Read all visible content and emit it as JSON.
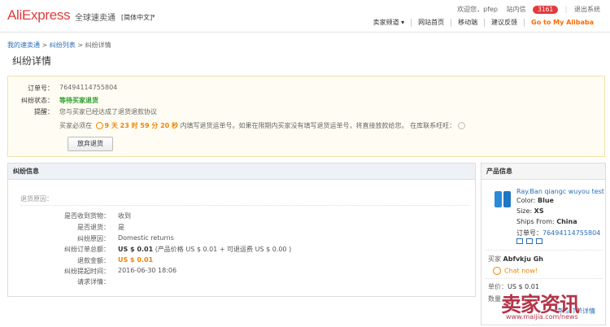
{
  "header": {
    "logo_main": "AliExpress",
    "logo_sub": "全球速卖通",
    "language": "[简体中文]",
    "greeting": "欢迎您，",
    "username": "pfep",
    "inbox_label": "站内信",
    "inbox_count": "3161",
    "logout": "退出系统",
    "nav": [
      "卖家频道",
      "网站首页",
      "移动端",
      "建议反馈"
    ],
    "alibaba": "Go to My Alibaba"
  },
  "breadcrumb": {
    "items": [
      "我的速卖通",
      "纠纷列表",
      "纠纷详情"
    ],
    "separator": ">"
  },
  "page_title": "纠纷详情",
  "summary": {
    "order_label": "订单号：",
    "order_no": "76494114755804",
    "status_label": "纠纷状态：",
    "status": "等待买家退货",
    "tip_label": "提醒：",
    "tip": "您与买家已经达成了退货退款协议",
    "countdown_prefix": "买家必须在",
    "countdown": "9 天 23 时 59 分 20 秒",
    "countdown_suffix": "内填写退货运单号。如果在限期内买家没有填写退货运单号，将直接放款给您。 在库联系旺旺：",
    "abandon_button": "放弃退货"
  },
  "dispute": {
    "title": "纠纷信息",
    "reason_header": "退货原因：",
    "fields": [
      {
        "label": "是否收到货物：",
        "value": "收到"
      },
      {
        "label": "是否退货：",
        "value": "是"
      },
      {
        "label": "纠纷原因：",
        "value": "Domestic returns"
      },
      {
        "label": "纠纷订单总额：",
        "value_bold": "US $ 0.01",
        "value": "(产品价格 US $ 0.01 + 可退运费 US $ 0.00 )"
      },
      {
        "label": "退款金额：",
        "value_orange": "US $ 0.01"
      },
      {
        "label": "纠纷提起时间：",
        "value": "2016-06-30 18:06"
      },
      {
        "label": "请求详情：",
        "value": ""
      }
    ]
  },
  "product": {
    "title": "产品信息",
    "name": "Ray.Ban qiangc wuyou test",
    "color_label": "Color:",
    "color": "Blue",
    "size_label": "Size:",
    "size": "XS",
    "ships_label": "Ships From:",
    "ships": "China",
    "order_label": "订单号：",
    "order_no": "76494114755804",
    "buyer_label": "买家",
    "buyer": "Abfvkju Gh",
    "chat": "Chat now!",
    "unit_price_label": "单价：",
    "unit_price": "US $ 0.01",
    "qty_label": "数量",
    "view_order": "查看订单详情"
  },
  "watermark": {
    "text": "卖家资讯",
    "url": "www.maijia.com/news"
  },
  "colors": {
    "brand_red": "#e4393c",
    "brand_orange": "#f08200",
    "link_blue": "#2a6ebb",
    "status_green": "#2c9c2c"
  }
}
